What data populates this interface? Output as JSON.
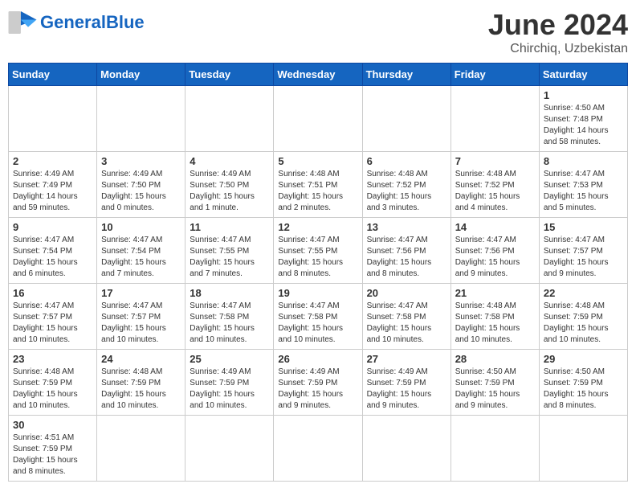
{
  "header": {
    "logo_general": "General",
    "logo_blue": "Blue",
    "title": "June 2024",
    "subtitle": "Chirchiq, Uzbekistan"
  },
  "days_of_week": [
    "Sunday",
    "Monday",
    "Tuesday",
    "Wednesday",
    "Thursday",
    "Friday",
    "Saturday"
  ],
  "weeks": [
    [
      {
        "day": "",
        "info": ""
      },
      {
        "day": "",
        "info": ""
      },
      {
        "day": "",
        "info": ""
      },
      {
        "day": "",
        "info": ""
      },
      {
        "day": "",
        "info": ""
      },
      {
        "day": "",
        "info": ""
      },
      {
        "day": "1",
        "info": "Sunrise: 4:50 AM\nSunset: 7:48 PM\nDaylight: 14 hours and 58 minutes."
      }
    ],
    [
      {
        "day": "2",
        "info": "Sunrise: 4:49 AM\nSunset: 7:49 PM\nDaylight: 14 hours and 59 minutes."
      },
      {
        "day": "3",
        "info": "Sunrise: 4:49 AM\nSunset: 7:50 PM\nDaylight: 15 hours and 0 minutes."
      },
      {
        "day": "4",
        "info": "Sunrise: 4:49 AM\nSunset: 7:50 PM\nDaylight: 15 hours and 1 minute."
      },
      {
        "day": "5",
        "info": "Sunrise: 4:48 AM\nSunset: 7:51 PM\nDaylight: 15 hours and 2 minutes."
      },
      {
        "day": "6",
        "info": "Sunrise: 4:48 AM\nSunset: 7:52 PM\nDaylight: 15 hours and 3 minutes."
      },
      {
        "day": "7",
        "info": "Sunrise: 4:48 AM\nSunset: 7:52 PM\nDaylight: 15 hours and 4 minutes."
      },
      {
        "day": "8",
        "info": "Sunrise: 4:47 AM\nSunset: 7:53 PM\nDaylight: 15 hours and 5 minutes."
      }
    ],
    [
      {
        "day": "9",
        "info": "Sunrise: 4:47 AM\nSunset: 7:54 PM\nDaylight: 15 hours and 6 minutes."
      },
      {
        "day": "10",
        "info": "Sunrise: 4:47 AM\nSunset: 7:54 PM\nDaylight: 15 hours and 7 minutes."
      },
      {
        "day": "11",
        "info": "Sunrise: 4:47 AM\nSunset: 7:55 PM\nDaylight: 15 hours and 7 minutes."
      },
      {
        "day": "12",
        "info": "Sunrise: 4:47 AM\nSunset: 7:55 PM\nDaylight: 15 hours and 8 minutes."
      },
      {
        "day": "13",
        "info": "Sunrise: 4:47 AM\nSunset: 7:56 PM\nDaylight: 15 hours and 8 minutes."
      },
      {
        "day": "14",
        "info": "Sunrise: 4:47 AM\nSunset: 7:56 PM\nDaylight: 15 hours and 9 minutes."
      },
      {
        "day": "15",
        "info": "Sunrise: 4:47 AM\nSunset: 7:57 PM\nDaylight: 15 hours and 9 minutes."
      }
    ],
    [
      {
        "day": "16",
        "info": "Sunrise: 4:47 AM\nSunset: 7:57 PM\nDaylight: 15 hours and 10 minutes."
      },
      {
        "day": "17",
        "info": "Sunrise: 4:47 AM\nSunset: 7:57 PM\nDaylight: 15 hours and 10 minutes."
      },
      {
        "day": "18",
        "info": "Sunrise: 4:47 AM\nSunset: 7:58 PM\nDaylight: 15 hours and 10 minutes."
      },
      {
        "day": "19",
        "info": "Sunrise: 4:47 AM\nSunset: 7:58 PM\nDaylight: 15 hours and 10 minutes."
      },
      {
        "day": "20",
        "info": "Sunrise: 4:47 AM\nSunset: 7:58 PM\nDaylight: 15 hours and 10 minutes."
      },
      {
        "day": "21",
        "info": "Sunrise: 4:48 AM\nSunset: 7:58 PM\nDaylight: 15 hours and 10 minutes."
      },
      {
        "day": "22",
        "info": "Sunrise: 4:48 AM\nSunset: 7:59 PM\nDaylight: 15 hours and 10 minutes."
      }
    ],
    [
      {
        "day": "23",
        "info": "Sunrise: 4:48 AM\nSunset: 7:59 PM\nDaylight: 15 hours and 10 minutes."
      },
      {
        "day": "24",
        "info": "Sunrise: 4:48 AM\nSunset: 7:59 PM\nDaylight: 15 hours and 10 minutes."
      },
      {
        "day": "25",
        "info": "Sunrise: 4:49 AM\nSunset: 7:59 PM\nDaylight: 15 hours and 10 minutes."
      },
      {
        "day": "26",
        "info": "Sunrise: 4:49 AM\nSunset: 7:59 PM\nDaylight: 15 hours and 9 minutes."
      },
      {
        "day": "27",
        "info": "Sunrise: 4:49 AM\nSunset: 7:59 PM\nDaylight: 15 hours and 9 minutes."
      },
      {
        "day": "28",
        "info": "Sunrise: 4:50 AM\nSunset: 7:59 PM\nDaylight: 15 hours and 9 minutes."
      },
      {
        "day": "29",
        "info": "Sunrise: 4:50 AM\nSunset: 7:59 PM\nDaylight: 15 hours and 8 minutes."
      }
    ],
    [
      {
        "day": "30",
        "info": "Sunrise: 4:51 AM\nSunset: 7:59 PM\nDaylight: 15 hours and 8 minutes."
      },
      {
        "day": "",
        "info": ""
      },
      {
        "day": "",
        "info": ""
      },
      {
        "day": "",
        "info": ""
      },
      {
        "day": "",
        "info": ""
      },
      {
        "day": "",
        "info": ""
      },
      {
        "day": "",
        "info": ""
      }
    ]
  ]
}
